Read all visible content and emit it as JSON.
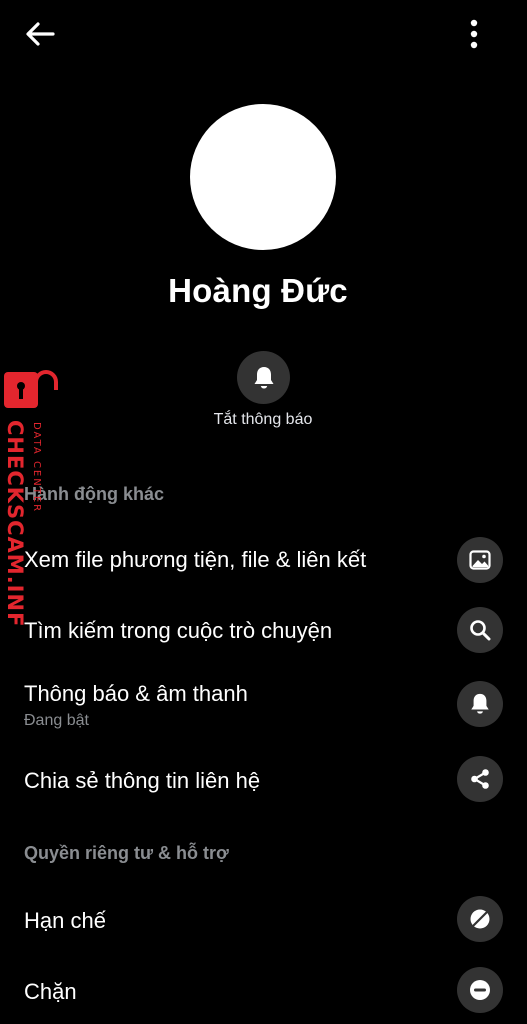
{
  "header": {
    "back_icon": "arrow-left-icon",
    "more_icon": "more-vertical-icon"
  },
  "profile": {
    "name": "Hoàng Đức",
    "mute_label": "Tắt thông báo",
    "mute_icon": "bell-icon"
  },
  "sections": {
    "other_actions": "Hành động khác",
    "privacy_support": "Quyền riêng tư & hỗ trợ"
  },
  "actions": {
    "view_media": {
      "label": "Xem file phương tiện, file & liên kết",
      "icon": "image-icon"
    },
    "search_chat": {
      "label": "Tìm kiếm trong cuộc trò chuyện",
      "icon": "search-icon"
    },
    "notifications": {
      "label": "Thông báo & âm thanh",
      "status": "Đang bật",
      "icon": "bell-icon"
    },
    "share_contact": {
      "label": "Chia sẻ thông tin liên hệ",
      "icon": "share-icon"
    },
    "restrict": {
      "label": "Hạn chế",
      "icon": "restrict-icon"
    },
    "block": {
      "label": "Chặn",
      "icon": "block-icon"
    }
  },
  "watermark": {
    "brand": "CHECKSCAM.INFO",
    "tagline": "DATA CENTER",
    "color": "#e3262e"
  },
  "colors": {
    "background": "#000000",
    "icon_circle": "#333333",
    "secondary_text": "#8a8d91"
  }
}
